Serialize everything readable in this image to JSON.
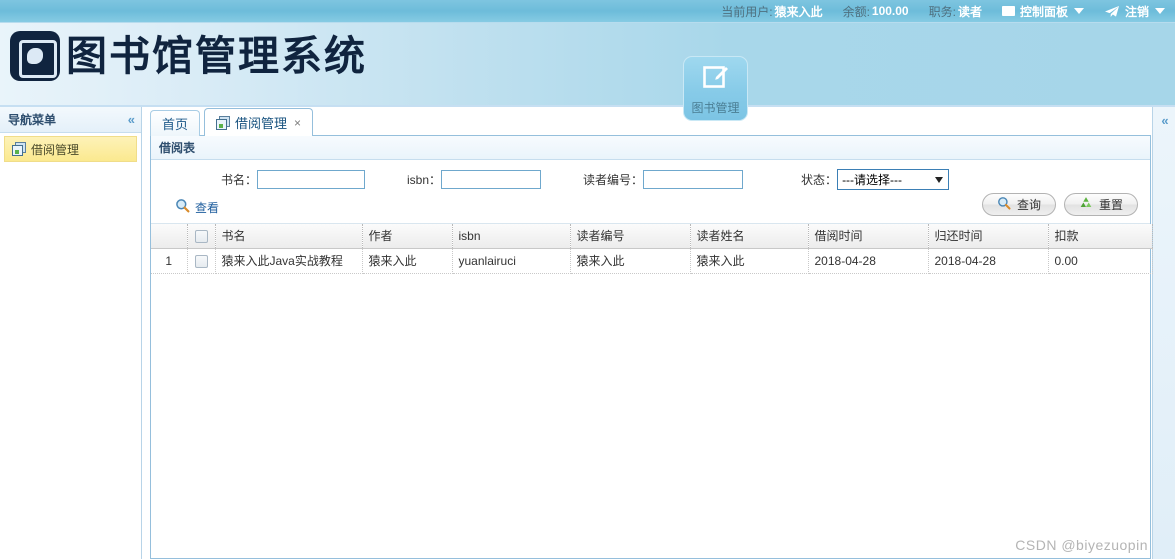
{
  "topbar": {
    "current_user_label": "当前用户:",
    "current_user_value": "猿来入此",
    "balance_label": "余额:",
    "balance_value": "100.00",
    "role_label": "职务:",
    "role_value": "读者",
    "control_panel": "控制面板",
    "logout": "注销",
    "panel_icon": "window-icon",
    "logout_icon": "paper-plane-icon"
  },
  "header": {
    "system_title": "图书馆管理系统",
    "logo_icon": "book-logo-icon",
    "hero_button": {
      "label": "图书管理",
      "icon": "edit-square-icon"
    }
  },
  "sidebar": {
    "title": "导航菜单",
    "collapse_icon": "chevron-double-left-icon",
    "items": [
      {
        "label": "借阅管理",
        "icon": "windows-stack-icon",
        "selected": true
      }
    ]
  },
  "tabs": [
    {
      "label": "首页",
      "active": false,
      "closable": false,
      "icon": ""
    },
    {
      "label": "借阅管理",
      "active": true,
      "closable": true,
      "icon": "windows-stack-icon",
      "close_glyph": "×"
    }
  ],
  "right_collapse_icon": "chevron-double-left-icon",
  "panel": {
    "title": "借阅表",
    "search": {
      "book_name_label": "书名：",
      "book_name_value": "",
      "isbn_label": "isbn：",
      "isbn_value": "",
      "reader_no_label": "读者编号：",
      "reader_no_value": "",
      "status_label": "状态：",
      "status_selected": "---请选择---",
      "status_options": [
        "---请选择---"
      ],
      "view_link": "查看",
      "view_icon": "magnifier-icon",
      "query_button": "查询",
      "query_icon": "magnifier-icon",
      "reset_button": "重置",
      "reset_icon": "recycle-icon"
    },
    "table": {
      "columns": [
        "",
        "",
        "书名",
        "作者",
        "isbn",
        "读者编号",
        "读者姓名",
        "借阅时间",
        "归还时间",
        "扣款"
      ],
      "rows": [
        {
          "index": "1",
          "book_name": "猿来入此Java实战教程",
          "author": "猿来入此",
          "isbn": "yuanlairuci",
          "reader_no": "猿来入此",
          "reader_name": "猿来入此",
          "borrow_date": "2018-04-28",
          "return_date": "2018-04-28",
          "fine": "0.00"
        }
      ]
    }
  },
  "watermark": "CSDN @biyezuopin"
}
